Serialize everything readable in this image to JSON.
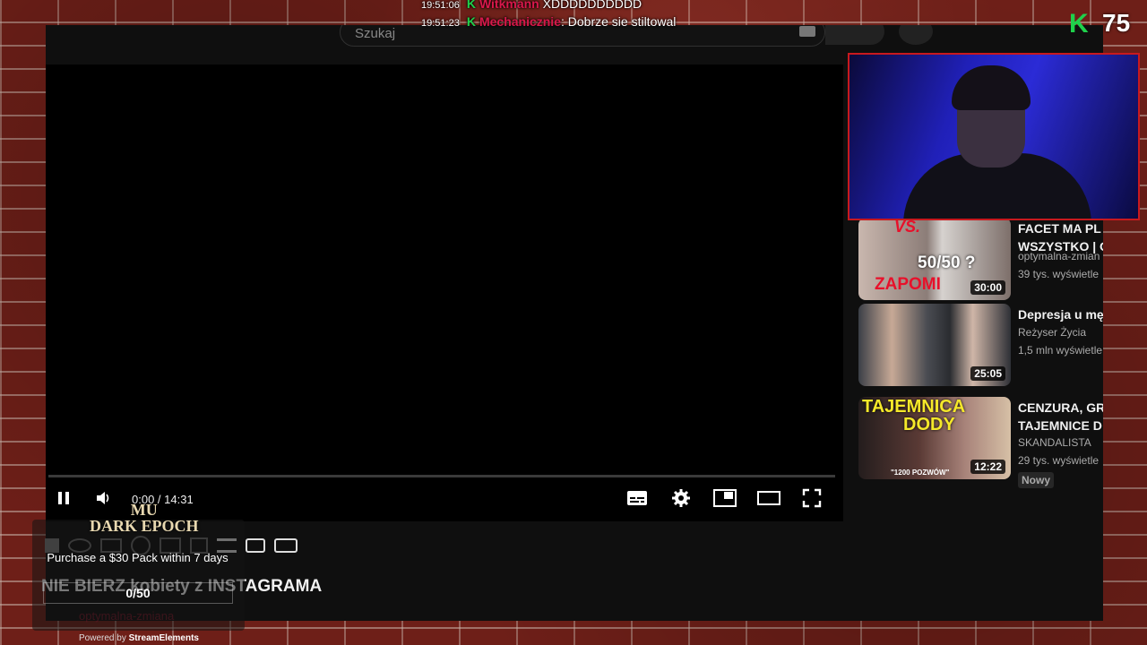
{
  "stream": {
    "kick_count": "75"
  },
  "chat": [
    {
      "time": "19:51:06",
      "user": "Witkmann",
      "message": "XDDDDDDDDDD"
    },
    {
      "time": "19:51:23",
      "user": "Mechanicznie",
      "message": "Dobrze sie stiltowal"
    }
  ],
  "youtube": {
    "search_placeholder": "Szukaj",
    "player": {
      "time": "0:00 / 14:31"
    },
    "video_title": "NIE BIERZ kobiety z INSTAGRAMA",
    "channel_ghost": "optymalna-zmiana",
    "recommended": [
      {
        "title": "FACET MA PL",
        "title2": "WSZYSTKO | O",
        "channel": "optymalna-zmian",
        "views": "39 tys. wyświetle",
        "duration": "30:00",
        "thumb_text": "50/50 ?",
        "thumb_text2": "ZAPOMI",
        "thumb_vs": "VS."
      },
      {
        "title": "Depresja u mę",
        "title2": "",
        "channel": "Reżyser Życia",
        "views": "1,5 mln wyświetle",
        "duration": "25:05"
      },
      {
        "title": "CENZURA, GR",
        "title2": "TAJEMNICE D",
        "channel": "SKANDALISTA",
        "views": "29 tys. wyświetle",
        "duration": "12:22",
        "badge": "Nowy",
        "thumb_text": "TAJEMNICA",
        "thumb_text2": "DODY",
        "thumb_caption": "\"1200 POZWÓW\""
      }
    ]
  },
  "widget": {
    "logo_line1": "MU",
    "logo_line2": "DARK EPOCH",
    "task": "Purchase a $30 Pack within 7 days",
    "progress": "0/50",
    "powered_prefix": "Powered by",
    "powered_brand": "StreamElements"
  },
  "colors": {
    "kick_green": "#1fd14b",
    "chat_user": "#d8184b",
    "webcam_border": "#c8191e"
  }
}
